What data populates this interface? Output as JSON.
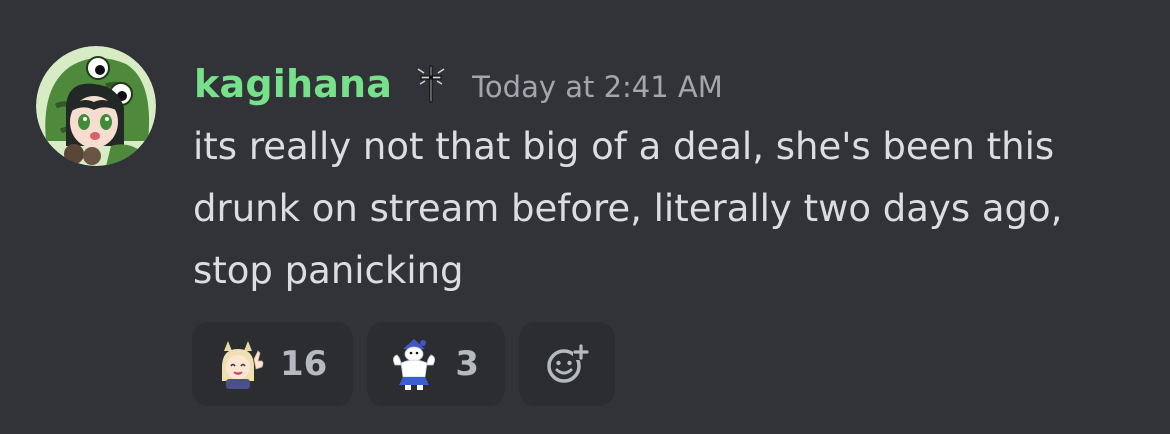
{
  "message": {
    "author": {
      "username": "kagihana",
      "username_color": "#77e08a",
      "avatar_icon": "avatar-frog-hood-character",
      "role_icon": "cross-icon"
    },
    "timestamp": "Today at 2:41 AM",
    "content": "its really not that big of a deal, she's been this drunk on stream before, literally two days ago, stop panicking"
  },
  "reactions": [
    {
      "emoji_icon": "anime-girl-thumbs-up-emoji",
      "count": "16"
    },
    {
      "emoji_icon": "muscular-snowman-emoji",
      "count": "3"
    }
  ],
  "add_reaction": {
    "icon": "add-reaction-icon"
  },
  "colors": {
    "background": "#313338",
    "reaction_bg": "#2b2d31",
    "text": "#dbdee1",
    "muted": "#a3a6ad"
  }
}
